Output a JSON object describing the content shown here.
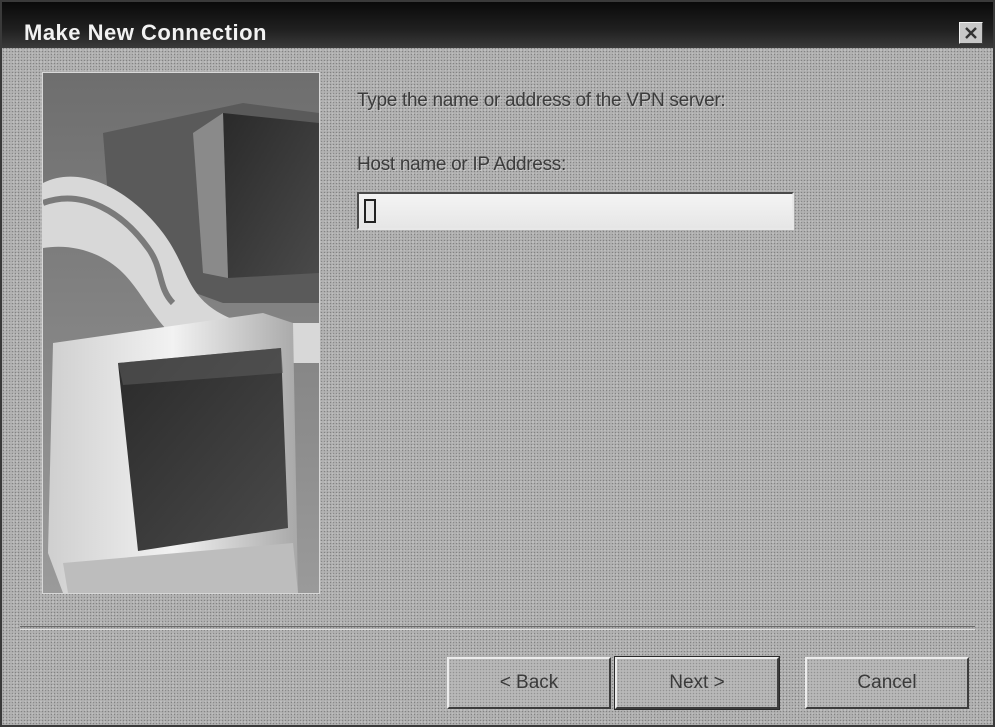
{
  "window": {
    "title": "Make New Connection"
  },
  "wizard": {
    "prompt": "Type the name or address of the VPN server:",
    "host_label": "Host name or IP Address:",
    "host_value": ""
  },
  "buttons": {
    "back": "< Back",
    "next": "Next >",
    "cancel": "Cancel"
  },
  "icons": {
    "close": "close-icon",
    "illustration": "computer-illustration"
  }
}
